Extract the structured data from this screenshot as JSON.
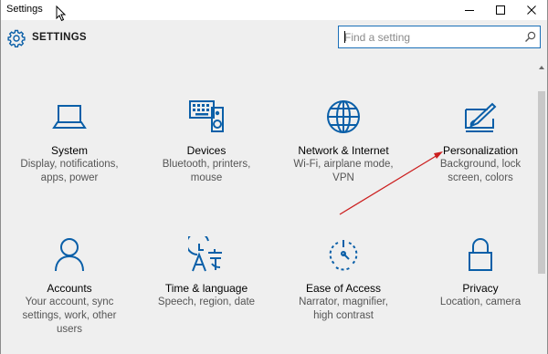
{
  "window": {
    "title": "Settings"
  },
  "header": {
    "title": "SETTINGS"
  },
  "search": {
    "placeholder": "Find a setting"
  },
  "tiles": [
    {
      "name": "System",
      "desc": [
        "Display, notifications,",
        "apps, power"
      ],
      "icon": "laptop-icon"
    },
    {
      "name": "Devices",
      "desc": [
        "Bluetooth, printers,",
        "mouse"
      ],
      "icon": "devices-icon"
    },
    {
      "name": "Network & Internet",
      "desc": [
        "Wi-Fi, airplane mode,",
        "VPN"
      ],
      "icon": "globe-icon"
    },
    {
      "name": "Personalization",
      "desc": [
        "Background, lock",
        "screen, colors"
      ],
      "icon": "paintbrush-icon"
    },
    {
      "name": "Accounts",
      "desc": [
        "Your account, sync",
        "settings, work, other",
        "users"
      ],
      "icon": "person-icon"
    },
    {
      "name": "Time & language",
      "desc": [
        "Speech, region, date"
      ],
      "icon": "time-language-icon"
    },
    {
      "name": "Ease of Access",
      "desc": [
        "Narrator, magnifier,",
        "high contrast"
      ],
      "icon": "ease-of-access-icon"
    },
    {
      "name": "Privacy",
      "desc": [
        "Location, camera"
      ],
      "icon": "lock-icon"
    }
  ],
  "colors": {
    "accent": "#0a5fa8",
    "annotation_arrow": "#cc1f1f"
  }
}
